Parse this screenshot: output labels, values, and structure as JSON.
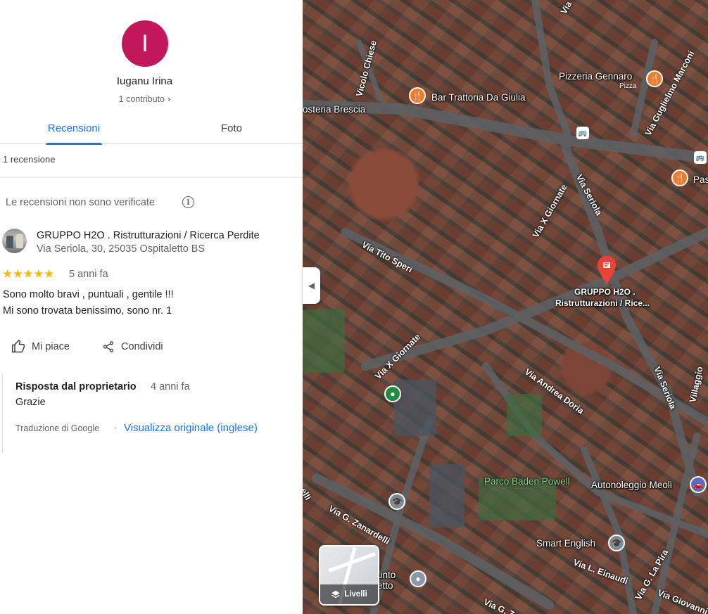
{
  "user": {
    "initial": "I",
    "name": "Iuganu Irina",
    "contributions": "1 contributo",
    "avatar_color": "#c2185b"
  },
  "tabs": [
    {
      "label": "Recensioni",
      "active": true
    },
    {
      "label": "Foto",
      "active": false
    }
  ],
  "review_count": "1 recensione",
  "notice": {
    "text": "Le recensioni non sono verificate",
    "icon": "info-icon"
  },
  "review": {
    "business_name": "GRUPPO H2O . Ristrutturazioni / Ricerca Perdite",
    "business_address": "Via Seriola, 30, 25035 Ospitaletto BS",
    "rating": 5,
    "stars": "★★★★★",
    "time_ago": "5 anni fa",
    "text_line1": "Sono molto bravi , puntuali , gentile !!!",
    "text_line2": "Mi sono trovata benissimo, sono nr. 1",
    "actions": {
      "like": "Mi piace",
      "share": "Condividi"
    },
    "owner_reply": {
      "title": "Risposta dal proprietario",
      "time_ago": "4 anni fa",
      "text": "Grazie",
      "translation_note": "Traduzione di Google",
      "separator": "·",
      "view_original": "Visualizza originale (inglese)"
    }
  },
  "map": {
    "places": [
      {
        "name": "Pizzeria Gennaro",
        "sub": "Pizza",
        "type": "food"
      },
      {
        "name": "Bar Trattoria Da Giulia",
        "type": "food"
      },
      {
        "name": "osteria Brescia",
        "type": "label"
      },
      {
        "name": "Pas",
        "type": "food"
      },
      {
        "name": "Autonoleggio Meoli",
        "type": "car"
      },
      {
        "name": "Smart English",
        "type": "school"
      },
      {
        "name": "unto",
        "type": "label"
      },
      {
        "name": "etto",
        "type": "label"
      }
    ],
    "park": "Parco Baden Powell",
    "selected_line1": "GRUPPO H2O .",
    "selected_line2": "Ristrutturazioni / Rice...",
    "roads": [
      "Vicolo Chiese",
      "Via Tito Speri",
      "Via X Giornate",
      "Via X Giornate",
      "Via Seriola",
      "Via Seriola",
      "Via Andrea Doria",
      "Via G. Zanardelli",
      "Via L. Einaudi",
      "Via G. La Pira",
      "Via Giovanni",
      "Via G. Zan",
      "Via Guglielmo Marconi",
      "Villaggio",
      "elli",
      "Via"
    ],
    "layers_label": "Livelli",
    "colors": {
      "food": "#f07c28",
      "green": "#1e8e3e",
      "pin": "#ea4335",
      "park_text": "#8fd18a"
    }
  }
}
